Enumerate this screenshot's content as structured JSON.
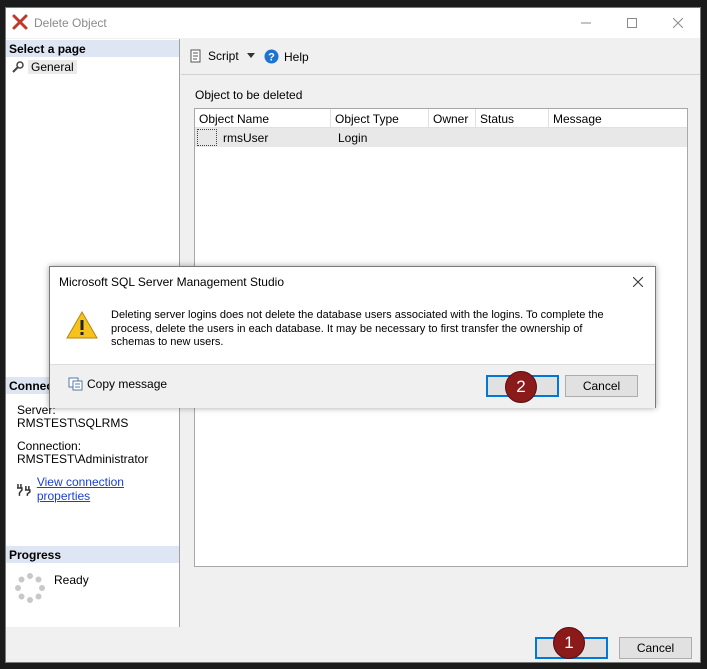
{
  "window": {
    "title": "Delete Object"
  },
  "left_pane": {
    "select_page_header": "Select a page",
    "pages": [
      {
        "label": "General"
      }
    ],
    "connection_header": "Connection",
    "server_label": "Server:",
    "server_value": "RMSTEST\\SQLRMS",
    "connection_label": "Connection:",
    "connection_value": "RMSTEST\\Administrator",
    "view_connection_link": "View connection properties",
    "progress_header": "Progress",
    "progress_status": "Ready"
  },
  "toolbar": {
    "script_label": "Script",
    "help_label": "Help"
  },
  "main": {
    "object_label": "Object to be deleted",
    "columns": [
      "Object Name",
      "Object Type",
      "Owner",
      "Status",
      "Message"
    ],
    "rows": [
      {
        "name": "rmsUser",
        "type": "Login",
        "owner": "",
        "status": "",
        "message": ""
      }
    ]
  },
  "bottom": {
    "ok_label": "",
    "cancel_label": "Cancel"
  },
  "dialog": {
    "title": "Microsoft SQL Server Management Studio",
    "message": "Deleting server logins does not delete the database users associated with the logins. To complete the process, delete the users in each database. It may be necessary to first transfer the ownership of schemas to new users.",
    "copy_label": "Copy message",
    "ok_label": "",
    "cancel_label": "Cancel"
  },
  "annotations": {
    "badge1": "1",
    "badge2": "2"
  },
  "colors": {
    "accent": "#0078d7",
    "badge": "#8b1a1a",
    "section_header": "#dde6f2",
    "link": "#1a3fd6"
  }
}
